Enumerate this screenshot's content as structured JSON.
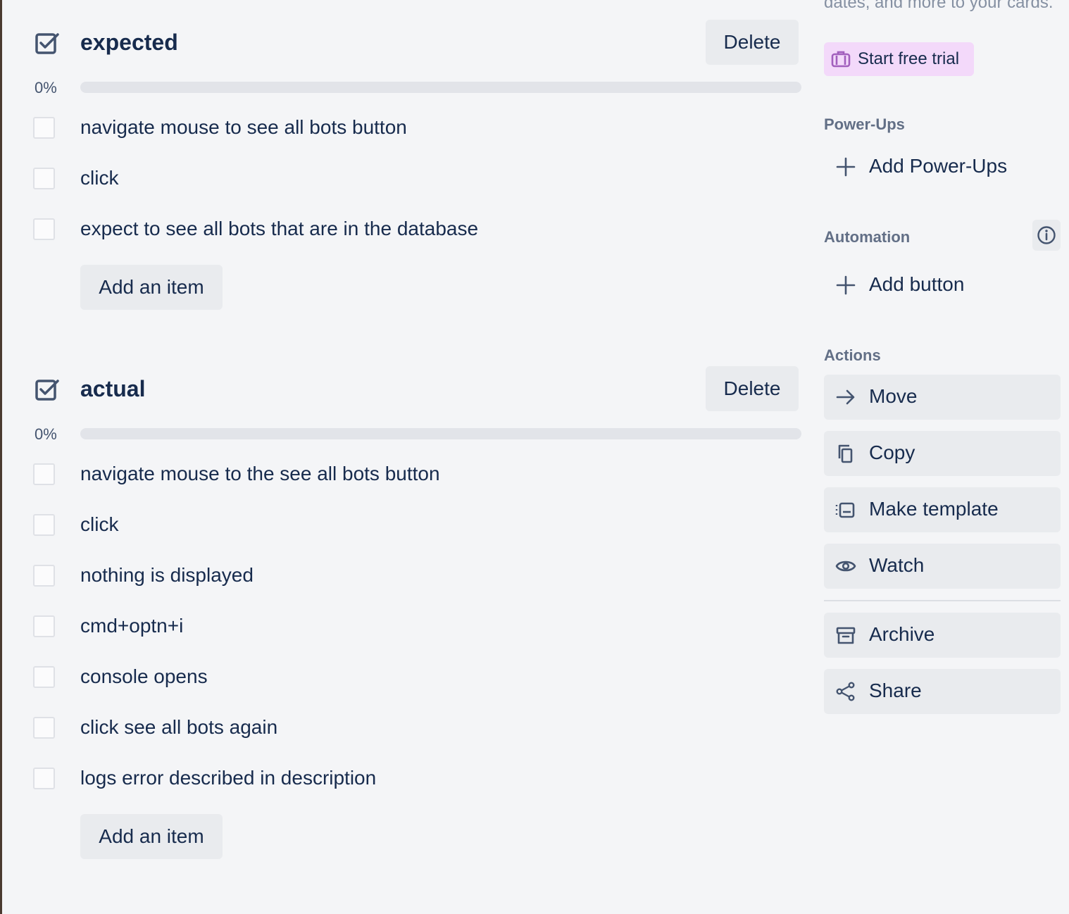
{
  "checklists": [
    {
      "title": "expected",
      "delete_label": "Delete",
      "progress_text": "0%",
      "progress": 0,
      "items": [
        "navigate mouse to see all bots button",
        "click",
        "expect to see all bots that are in the database"
      ],
      "add_label": "Add an item"
    },
    {
      "title": "actual",
      "delete_label": "Delete",
      "progress_text": "0%",
      "progress": 0,
      "items": [
        "navigate mouse to the see all bots button",
        "click",
        "nothing is displayed",
        "cmd+optn+i",
        "console opens",
        "click see all bots again",
        "logs error described in description"
      ],
      "add_label": "Add an item"
    }
  ],
  "sidebar": {
    "promo_text": "dates, and more to your cards.",
    "trial_label": "Start free trial",
    "powerups_heading": "Power-Ups",
    "add_powerups_label": "Add Power-Ups",
    "automation_heading": "Automation",
    "add_button_label": "Add button",
    "actions_heading": "Actions",
    "actions": [
      {
        "label": "Move",
        "icon": "arrow-right-icon"
      },
      {
        "label": "Copy",
        "icon": "copy-icon"
      },
      {
        "label": "Make template",
        "icon": "template-icon"
      },
      {
        "label": "Watch",
        "icon": "eye-icon"
      }
    ],
    "secondary_actions": [
      {
        "label": "Archive",
        "icon": "archive-icon"
      },
      {
        "label": "Share",
        "icon": "share-icon"
      }
    ]
  },
  "colors": {
    "background": "#f4f5f7",
    "text": "#172b4d",
    "button": "#e9ebee",
    "trial": "#f3d9fa",
    "trial_icon": "#a25fbd"
  }
}
